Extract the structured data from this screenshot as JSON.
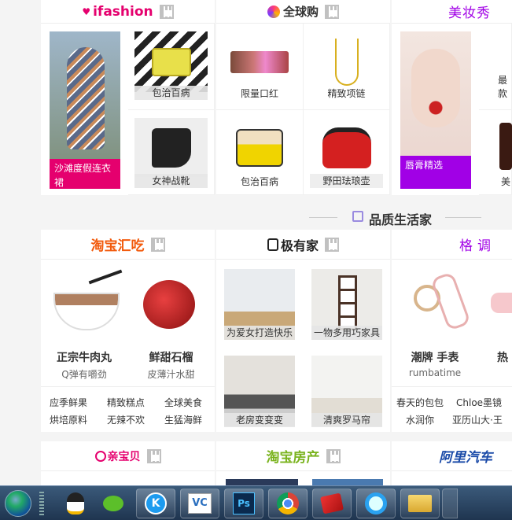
{
  "row1": {
    "ifashion": {
      "logo": "ifashion",
      "hero_caption": "沙滩度假连衣裙",
      "items": [
        {
          "label": "包治百病"
        },
        {
          "label": "女神战靴"
        }
      ]
    },
    "global": {
      "logo": "全球购",
      "items": [
        {
          "label": "限量口红"
        },
        {
          "label": "精致项链"
        },
        {
          "label": "包治百病"
        },
        {
          "label": "野田珐琅壶"
        }
      ]
    },
    "beauty": {
      "title": "美妆秀",
      "hero_caption": "唇膏精选",
      "side_labels": [
        "最款",
        "美"
      ]
    }
  },
  "section_title": "品质生活家",
  "row2": {
    "huichi": {
      "logo": "淘宝汇吃",
      "items": [
        {
          "title": "正宗牛肉丸",
          "sub": "Q弹有嚼劲"
        },
        {
          "title": "鲜甜石榴",
          "sub": "皮薄汁水甜"
        }
      ],
      "links": [
        "应季鲜果",
        "精致糕点",
        "全球美食",
        "烘培原料",
        "无辣不欢",
        "生猛海鲜"
      ]
    },
    "jiyoujia": {
      "logo": "极有家",
      "items": [
        {
          "label": "为爱女打造快乐"
        },
        {
          "label": "一物多用巧家具"
        },
        {
          "label": "老房变变变"
        },
        {
          "label": "清爽罗马帘"
        }
      ]
    },
    "gediao": {
      "title": "格调",
      "items": [
        {
          "title": "潮牌 手表",
          "sub": "rumbatime"
        },
        {
          "title": "热"
        }
      ],
      "links": [
        "春天的包包",
        "Chloe墨镜",
        "水润你",
        "亚历山大·王"
      ]
    }
  },
  "row3": {
    "a": {
      "logo": "亲宝贝"
    },
    "b": {
      "logo": "淘宝房产"
    },
    "c": {
      "logo": "阿里汽车"
    }
  },
  "taskbar": {
    "icons": [
      "start-orb",
      "qq",
      "wechat",
      "kugou",
      "vc",
      "photoshop",
      "chrome",
      "red-app",
      "qq-browser",
      "folder",
      "more"
    ]
  },
  "colors": {
    "pink": "#e5006e",
    "purple": "#a100e6",
    "orange": "#f25a0c",
    "green": "#7ab31e"
  }
}
